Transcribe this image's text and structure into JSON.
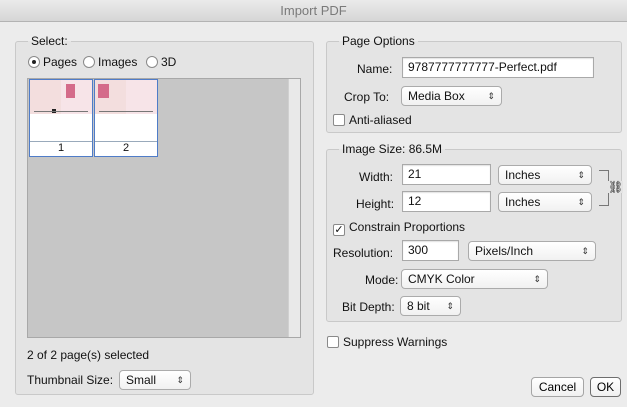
{
  "window": {
    "title": "Import PDF"
  },
  "select": {
    "legend": "Select:",
    "options": [
      {
        "label": "Pages",
        "selected": true
      },
      {
        "label": "Images",
        "selected": false
      },
      {
        "label": "3D",
        "selected": false
      }
    ],
    "thumbnails": [
      {
        "number": "1"
      },
      {
        "number": "2"
      }
    ],
    "selection_status": "2 of 2 page(s) selected",
    "thumbnail_size_label": "Thumbnail Size:",
    "thumbnail_size_value": "Small"
  },
  "page_options": {
    "legend": "Page Options",
    "name_label": "Name:",
    "name_value": "9787777777777-Perfect.pdf",
    "crop_label": "Crop To:",
    "crop_value": "Media Box",
    "anti_aliased_label": "Anti-aliased",
    "anti_aliased_checked": false
  },
  "image_size": {
    "legend": "Image Size: 86.5M",
    "width_label": "Width:",
    "width_value": "21",
    "width_unit": "Inches",
    "height_label": "Height:",
    "height_value": "12",
    "height_unit": "Inches",
    "constrain_label": "Constrain Proportions",
    "constrain_checked": true,
    "resolution_label": "Resolution:",
    "resolution_value": "300",
    "resolution_unit": "Pixels/Inch",
    "mode_label": "Mode:",
    "mode_value": "CMYK Color",
    "bitdepth_label": "Bit Depth:",
    "bitdepth_value": "8 bit"
  },
  "suppress_warnings_label": "Suppress Warnings",
  "suppress_warnings_checked": false,
  "buttons": {
    "cancel": "Cancel",
    "ok": "OK"
  },
  "icons": {
    "checkmark": "✓",
    "popup_arrow": "⇕",
    "chain": "⛓"
  },
  "colors": {
    "selection_border": "#4f7cc8",
    "page_tint": "#f3dede"
  }
}
